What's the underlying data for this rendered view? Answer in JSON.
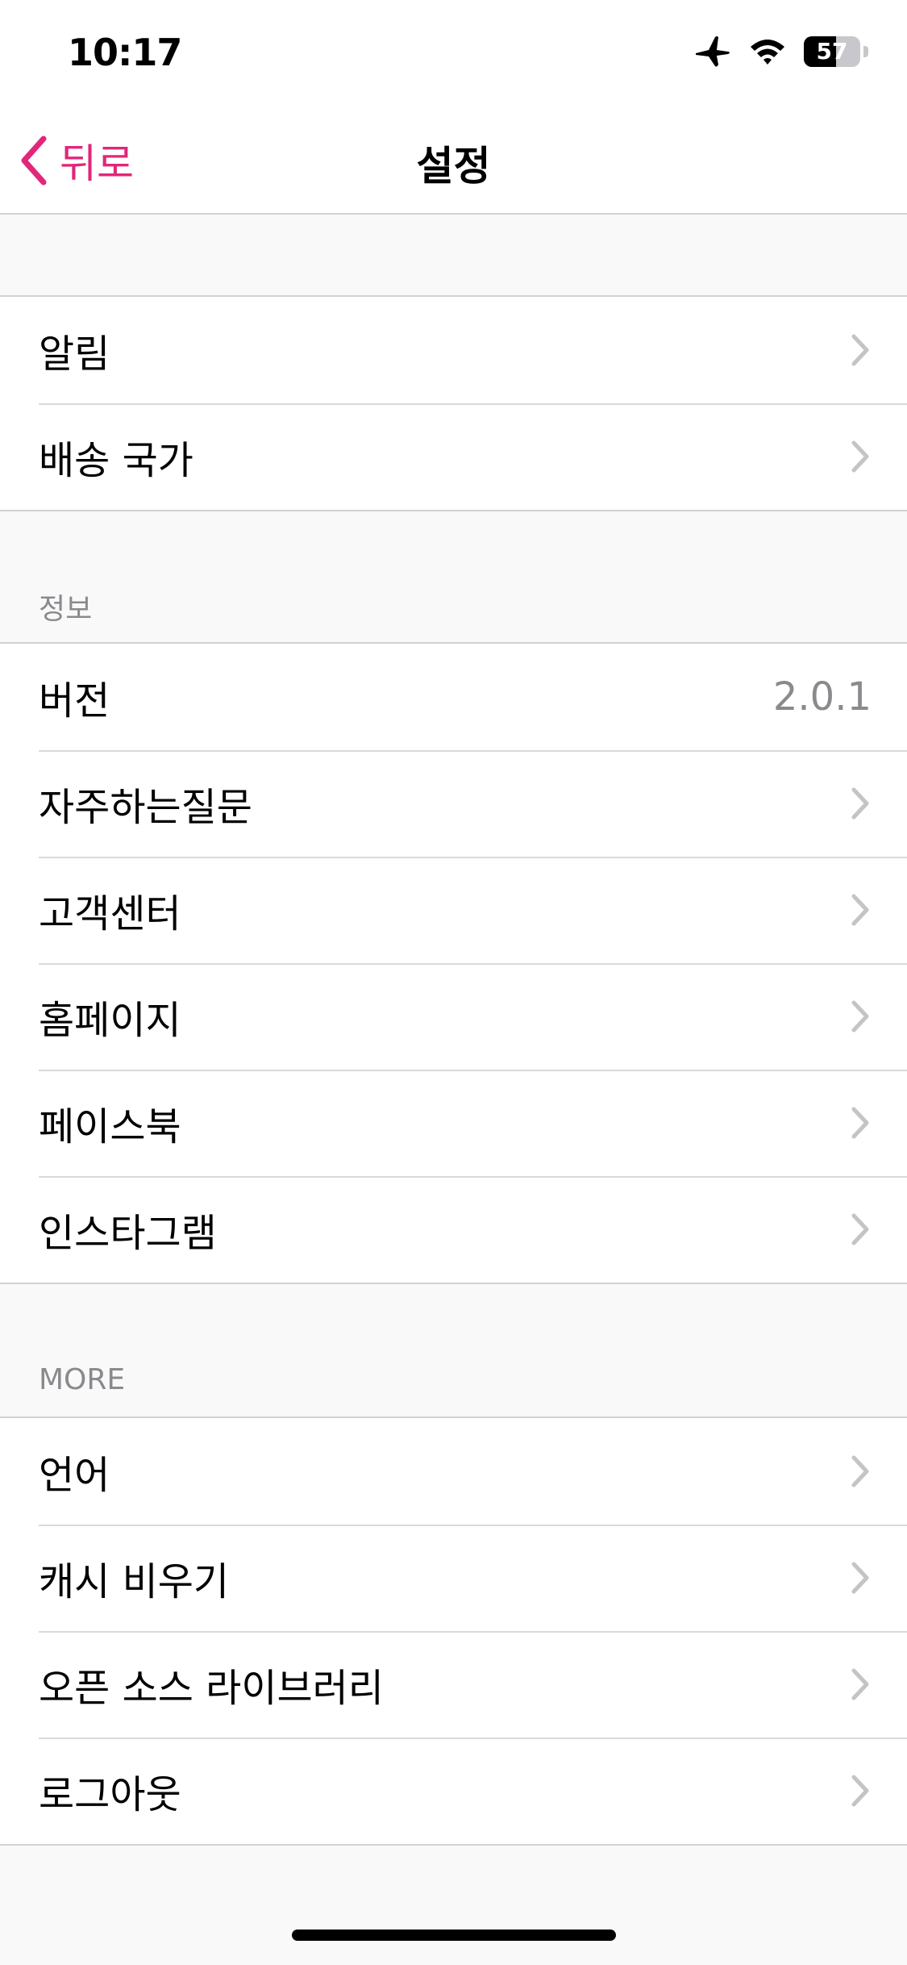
{
  "status_bar": {
    "time": "10:17",
    "icons": [
      "airplane-icon",
      "wifi-icon",
      "battery-icon"
    ],
    "battery_percent": "57",
    "battery_level": 0.57
  },
  "nav": {
    "back_label": "뒤로",
    "title": "설정",
    "accent_color": "#e0277a"
  },
  "group1": {
    "items": [
      {
        "label": "알림"
      },
      {
        "label": "배송 국가"
      }
    ]
  },
  "info": {
    "header": "정보",
    "version": {
      "label": "버전",
      "value": "2.0.1"
    },
    "items": [
      {
        "label": "자주하는질문"
      },
      {
        "label": "고객센터"
      },
      {
        "label": "홈페이지"
      },
      {
        "label": "페이스북"
      },
      {
        "label": "인스타그램"
      }
    ]
  },
  "more": {
    "header": "MORE",
    "items": [
      {
        "label": "언어"
      },
      {
        "label": "캐시 비우기"
      },
      {
        "label": "오픈 소스 라이브러리"
      },
      {
        "label": "로그아웃"
      }
    ]
  }
}
